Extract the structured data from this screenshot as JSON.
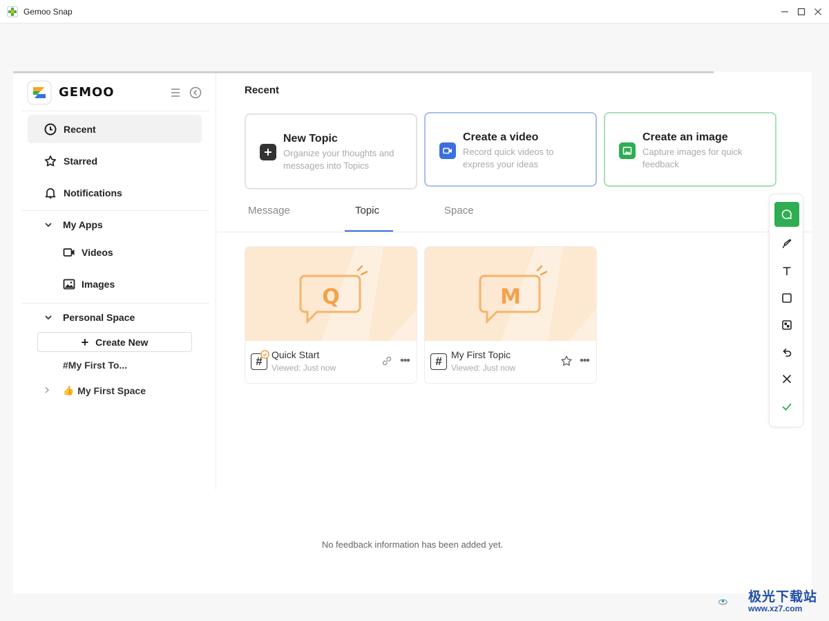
{
  "window": {
    "title": "Gemoo Snap",
    "minimize": "—",
    "maximize": "☐",
    "close": "✕"
  },
  "sidebar": {
    "logo_text": "GEMOO",
    "nav": [
      {
        "label": "Recent",
        "icon": "clock-icon",
        "active": true
      },
      {
        "label": "Starred",
        "icon": "star-icon",
        "active": false
      },
      {
        "label": "Notifications",
        "icon": "bell-icon",
        "active": false
      }
    ],
    "my_apps": {
      "label": "My Apps",
      "items": [
        {
          "label": "Videos",
          "icon": "video-icon"
        },
        {
          "label": "Images",
          "icon": "image-icon"
        }
      ]
    },
    "personal_space": {
      "label": "Personal Space",
      "create_new": "Create New",
      "topic": "#My First To...",
      "space": "My First Space",
      "space_emoji": "👍"
    }
  },
  "main": {
    "recent_title": "Recent",
    "cards": [
      {
        "title": "New Topic",
        "desc": "Organize your thoughts and messages into Topics",
        "icon": "plus-icon",
        "color": "#333333",
        "border": "#e3e3e3"
      },
      {
        "title": "Create a video",
        "desc": "Record quick videos to express your ideas",
        "icon": "video-icon",
        "color": "#3b6fe0",
        "border": "#a9bff0"
      },
      {
        "title": "Create an image",
        "desc": "Capture images for quick feedback",
        "icon": "image-icon",
        "color": "#2ead52",
        "border": "#a7e0b5"
      }
    ],
    "tabs": [
      "Message",
      "Topic",
      "Space"
    ],
    "active_tab": "Topic",
    "topics": [
      {
        "letter": "Q",
        "name": "Quick Start",
        "viewed": "Viewed: Just now",
        "action": "link-icon"
      },
      {
        "letter": "M",
        "name": "My First Topic",
        "viewed": "Viewed: Just now",
        "action": "star-icon"
      }
    ]
  },
  "toolbar": {
    "tools": [
      "comment-icon",
      "pen-icon",
      "text-icon",
      "rectangle-icon",
      "mosaic-icon",
      "undo-icon",
      "close-icon",
      "check-icon"
    ],
    "accent": "#2ead52"
  },
  "feedback": {
    "empty_text": "No feedback information has been added yet."
  },
  "watermark": {
    "cn": "极光下载站",
    "url": "www.xz7.com"
  }
}
